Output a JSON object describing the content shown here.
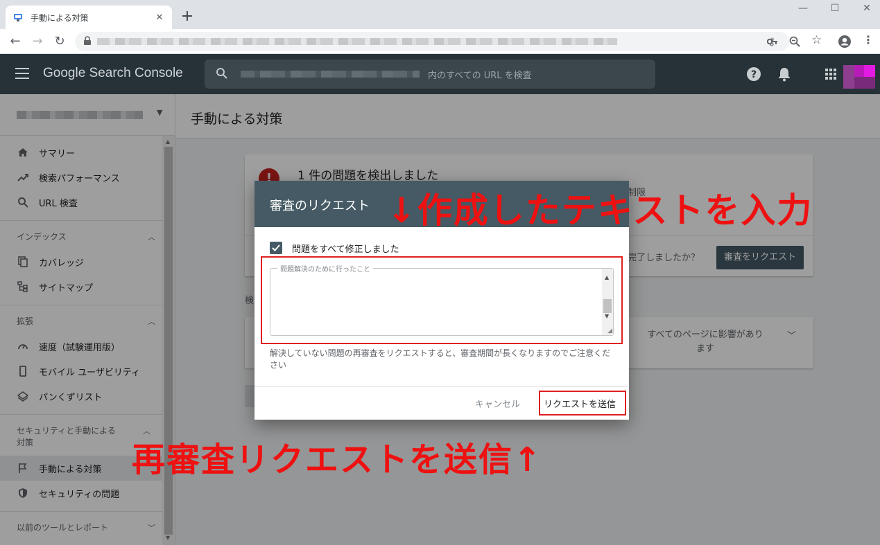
{
  "browser": {
    "tab_title": "手動による対策",
    "tab_close": "✕",
    "new_tab": "+",
    "minimize": "—",
    "maximize": "☐",
    "close": "✕"
  },
  "header": {
    "brand": "Google Search Console",
    "search_placeholder": "内のすべての URL を検査"
  },
  "sidebar": {
    "items_top": [
      {
        "label": "サマリー",
        "icon": "home-icon"
      },
      {
        "label": "検索パフォーマンス",
        "icon": "trending-icon"
      },
      {
        "label": "URL 検査",
        "icon": "search-icon"
      }
    ],
    "section_index": "インデックス",
    "items_index": [
      {
        "label": "カバレッジ",
        "icon": "copy-icon"
      },
      {
        "label": "サイトマップ",
        "icon": "sitemap-icon"
      }
    ],
    "section_enhance": "拡張",
    "items_enhance": [
      {
        "label": "速度（試験運用版）",
        "icon": "speed-icon"
      },
      {
        "label": "モバイル ユーザビリティ",
        "icon": "phone-icon"
      },
      {
        "label": "パンくずリスト",
        "icon": "layers-icon"
      }
    ],
    "section_security": "セキュリティと手動による対策",
    "items_security": [
      {
        "label": "手動による対策",
        "icon": "flag-icon"
      },
      {
        "label": "セキュリティの問題",
        "icon": "shield-icon"
      }
    ],
    "section_legacy": "以前のツールとレポート"
  },
  "main": {
    "page_title": "手動による対策",
    "issue_heading": "1 件の問題を検出しました",
    "issue_side_text": "制限",
    "request_question": "完了しましたか？",
    "request_button": "審査をリクエスト",
    "left_cut_text": "検",
    "affects_text": "すべてのページに影響があります"
  },
  "dialog": {
    "title": "審査のリクエスト",
    "checkbox_label": "問題をすべて修正しました",
    "textarea_legend": "問題解決のために行ったこと",
    "help_text": "解決していない問題の再審査をリクエストすると、審査期間が長くなりますのでご注意ください",
    "cancel": "キャンセル",
    "send": "リクエストを送信"
  },
  "annotations": {
    "top": "↓作成したテキストを入力",
    "bottom": "再審査リクエストを送信↑",
    "color": "#ee1111"
  }
}
